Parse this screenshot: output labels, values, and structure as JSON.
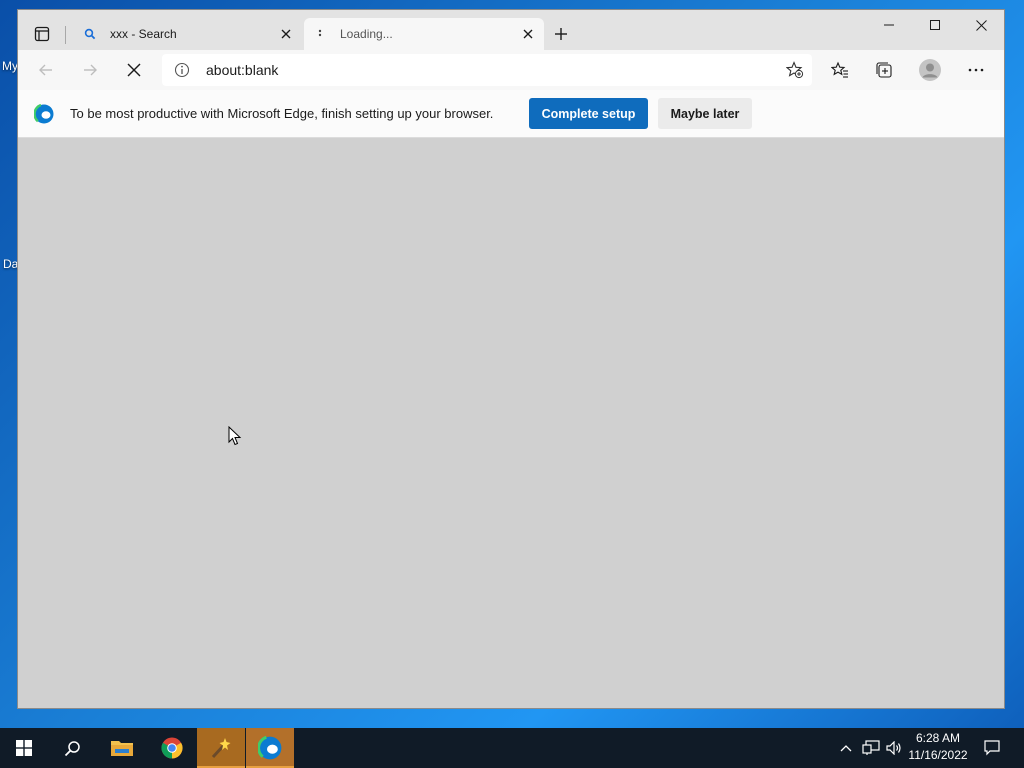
{
  "desktop": {
    "labels": [
      "My",
      "Da"
    ]
  },
  "browser": {
    "tabs": [
      {
        "title": "xxx - Search",
        "favicon": "search-icon",
        "active": false
      },
      {
        "title": "Loading...",
        "favicon": "loading-icon",
        "active": true
      }
    ],
    "address": {
      "url": "about:blank"
    },
    "infobar": {
      "message": "To be most productive with Microsoft Edge, finish setting up your browser.",
      "primary_label": "Complete setup",
      "secondary_label": "Maybe later"
    }
  },
  "taskbar": {
    "apps": [
      "start-icon",
      "search-icon",
      "file-explorer-icon",
      "chrome-icon",
      "magic-wand-app-icon",
      "edge-icon"
    ],
    "clock": {
      "time": "6:28 AM",
      "date": "11/16/2022"
    }
  },
  "colors": {
    "accent": "#0f6cbd",
    "taskbar": "#101b27",
    "content_bg": "#d0d0d0"
  }
}
